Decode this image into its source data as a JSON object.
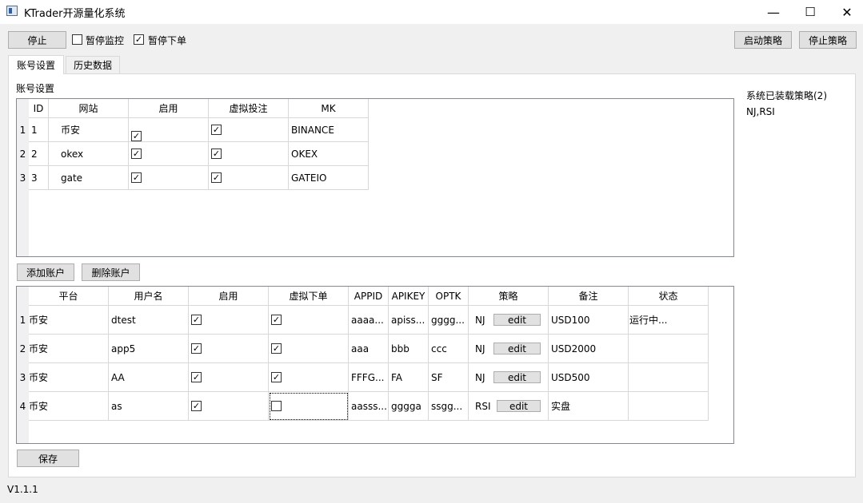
{
  "window": {
    "title": "KTrader开源量化系统",
    "minimize": "—",
    "maximize": "☐",
    "close": "✕"
  },
  "toolbar": {
    "stop_label": "停止",
    "pause_monitor_label": "暂停监控",
    "pause_monitor_checked": false,
    "pause_order_label": "暂停下单",
    "pause_order_checked": true,
    "start_strategy_label": "启动策略",
    "stop_strategy_label": "停止策略"
  },
  "tabs": [
    {
      "label": "账号设置",
      "active": true
    },
    {
      "label": "历史数据",
      "active": false
    }
  ],
  "section_title": "账号设置",
  "sites_table": {
    "headers": [
      "ID",
      "网站",
      "启用",
      "虚拟投注",
      "MK"
    ],
    "rows": [
      {
        "row_num": "1",
        "id": "1",
        "site": "币安",
        "enabled": true,
        "virtual": true,
        "mk": "BINANCE"
      },
      {
        "row_num": "2",
        "id": "2",
        "site": "okex",
        "enabled": true,
        "virtual": true,
        "mk": "OKEX"
      },
      {
        "row_num": "3",
        "id": "3",
        "site": "gate",
        "enabled": true,
        "virtual": true,
        "mk": "GATEIO"
      }
    ]
  },
  "account_buttons": {
    "add_label": "添加账户",
    "delete_label": "删除账户"
  },
  "accounts_table": {
    "headers": [
      "平台",
      "用户名",
      "启用",
      "虚拟下单",
      "APPID",
      "APIKEY",
      "OPTK",
      "策略",
      "备注",
      "状态"
    ],
    "rows": [
      {
        "row_num": "1",
        "platform": "币安",
        "username": "dtest",
        "enabled": true,
        "virtual": true,
        "appid": "aaaa...",
        "apikey": "apiss...",
        "optk": "gggg...",
        "strategy": "NJ",
        "edit": "edit",
        "note": "USD100",
        "status": "运行中..."
      },
      {
        "row_num": "2",
        "platform": "币安",
        "username": "app5",
        "enabled": true,
        "virtual": true,
        "appid": "aaa",
        "apikey": "bbb",
        "optk": "ccc",
        "strategy": "NJ",
        "edit": "edit",
        "note": "USD2000",
        "status": ""
      },
      {
        "row_num": "3",
        "platform": "币安",
        "username": "AA",
        "enabled": true,
        "virtual": true,
        "appid": "FFFG...",
        "apikey": "FA",
        "optk": "SF",
        "strategy": "NJ",
        "edit": "edit",
        "note": "USD500",
        "status": ""
      },
      {
        "row_num": "4",
        "platform": "币安",
        "username": "as",
        "enabled": true,
        "virtual": false,
        "appid": "aasss...",
        "apikey": "gggga",
        "optk": "ssgg...",
        "strategy": "RSI",
        "edit": "edit",
        "note": "实盘",
        "status": ""
      }
    ]
  },
  "save_label": "保存",
  "loaded_strategies": {
    "title": "系统已装载策略(2)",
    "list": "NJ,RSI"
  },
  "version": "V1.1.1"
}
